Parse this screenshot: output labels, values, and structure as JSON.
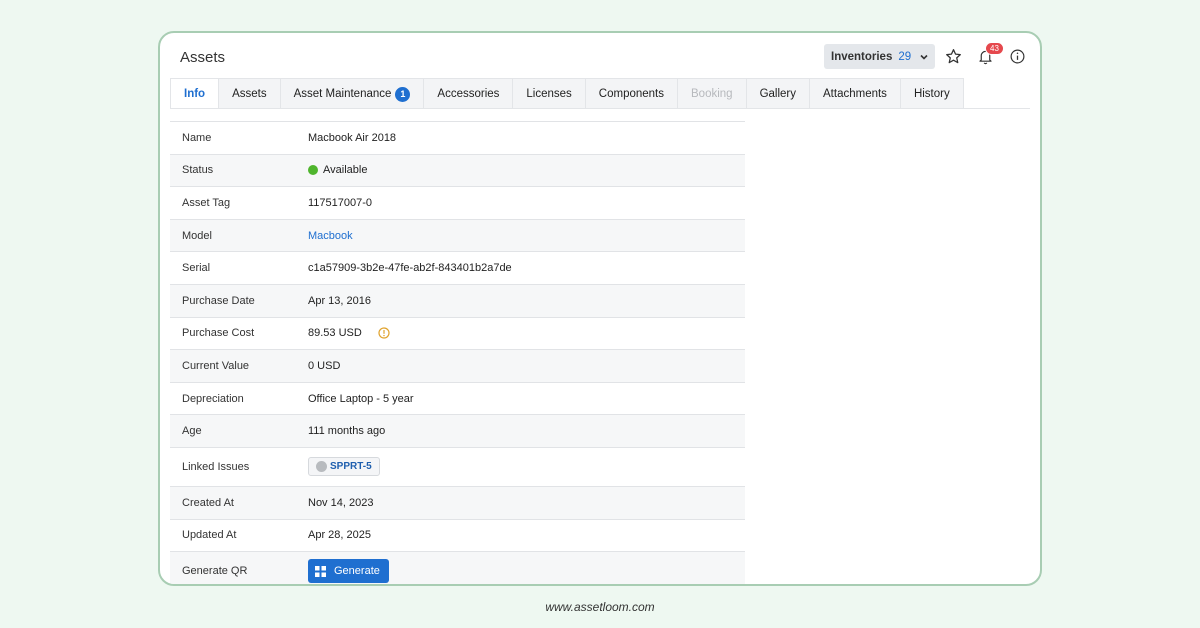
{
  "header": {
    "title": "Assets",
    "inventories_label": "Inventories",
    "inventories_count": "29",
    "notification_count": "43"
  },
  "tabs": [
    {
      "label": "Info",
      "state": "active"
    },
    {
      "label": "Assets",
      "state": "normal"
    },
    {
      "label": "Asset Maintenance",
      "state": "normal",
      "badge": "1"
    },
    {
      "label": "Accessories",
      "state": "normal"
    },
    {
      "label": "Licenses",
      "state": "normal"
    },
    {
      "label": "Components",
      "state": "normal"
    },
    {
      "label": "Booking",
      "state": "disabled"
    },
    {
      "label": "Gallery",
      "state": "normal"
    },
    {
      "label": "Attachments",
      "state": "normal"
    },
    {
      "label": "History",
      "state": "normal"
    }
  ],
  "details": {
    "name": {
      "label": "Name",
      "value": "Macbook Air 2018"
    },
    "status": {
      "label": "Status",
      "value": "Available",
      "color": "#4fb52d"
    },
    "asset_tag": {
      "label": "Asset Tag",
      "value": "117517007-0"
    },
    "model": {
      "label": "Model",
      "value": "Macbook"
    },
    "serial": {
      "label": "Serial",
      "value": "c1a57909-3b2e-47fe-ab2f-843401b2a7de"
    },
    "purchase_date": {
      "label": "Purchase Date",
      "value": "Apr 13, 2016"
    },
    "purchase_cost": {
      "label": "Purchase Cost",
      "value": "89.53 USD"
    },
    "current_value": {
      "label": "Current Value",
      "value": "0 USD"
    },
    "depreciation": {
      "label": "Depreciation",
      "value": "Office Laptop - 5 year"
    },
    "age": {
      "label": "Age",
      "value": "111 months ago"
    },
    "linked_issues": {
      "label": "Linked Issues",
      "value": "SPPRT-5"
    },
    "created_at": {
      "label": "Created At",
      "value": "Nov 14, 2023"
    },
    "updated_at": {
      "label": "Updated At",
      "value": "Apr 28, 2025"
    },
    "generate_qr": {
      "label": "Generate QR",
      "button": "Generate"
    }
  },
  "footer": {
    "url": "www.assetloom.com"
  },
  "colors": {
    "accent": "#1f6fd0",
    "badge": "#e5484d",
    "frame": "#a8cdb3"
  }
}
